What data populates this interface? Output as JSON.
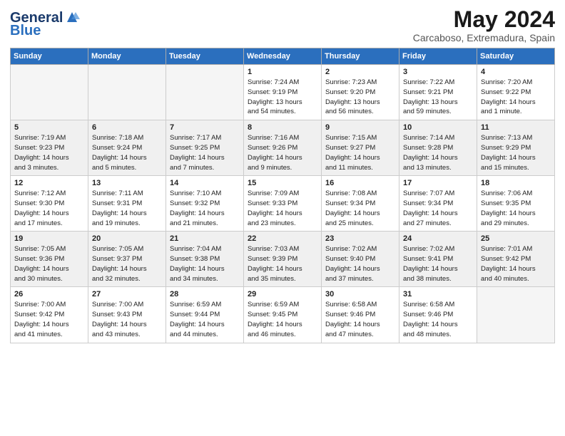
{
  "header": {
    "logo_line1": "General",
    "logo_line2": "Blue",
    "month": "May 2024",
    "location": "Carcaboso, Extremadura, Spain"
  },
  "days_of_week": [
    "Sunday",
    "Monday",
    "Tuesday",
    "Wednesday",
    "Thursday",
    "Friday",
    "Saturday"
  ],
  "weeks": [
    [
      {
        "day": "",
        "info": "",
        "empty": true
      },
      {
        "day": "",
        "info": "",
        "empty": true
      },
      {
        "day": "",
        "info": "",
        "empty": true
      },
      {
        "day": "1",
        "info": "Sunrise: 7:24 AM\nSunset: 9:19 PM\nDaylight: 13 hours\nand 54 minutes.",
        "empty": false
      },
      {
        "day": "2",
        "info": "Sunrise: 7:23 AM\nSunset: 9:20 PM\nDaylight: 13 hours\nand 56 minutes.",
        "empty": false
      },
      {
        "day": "3",
        "info": "Sunrise: 7:22 AM\nSunset: 9:21 PM\nDaylight: 13 hours\nand 59 minutes.",
        "empty": false
      },
      {
        "day": "4",
        "info": "Sunrise: 7:20 AM\nSunset: 9:22 PM\nDaylight: 14 hours\nand 1 minute.",
        "empty": false
      }
    ],
    [
      {
        "day": "5",
        "info": "Sunrise: 7:19 AM\nSunset: 9:23 PM\nDaylight: 14 hours\nand 3 minutes.",
        "empty": false
      },
      {
        "day": "6",
        "info": "Sunrise: 7:18 AM\nSunset: 9:24 PM\nDaylight: 14 hours\nand 5 minutes.",
        "empty": false
      },
      {
        "day": "7",
        "info": "Sunrise: 7:17 AM\nSunset: 9:25 PM\nDaylight: 14 hours\nand 7 minutes.",
        "empty": false
      },
      {
        "day": "8",
        "info": "Sunrise: 7:16 AM\nSunset: 9:26 PM\nDaylight: 14 hours\nand 9 minutes.",
        "empty": false
      },
      {
        "day": "9",
        "info": "Sunrise: 7:15 AM\nSunset: 9:27 PM\nDaylight: 14 hours\nand 11 minutes.",
        "empty": false
      },
      {
        "day": "10",
        "info": "Sunrise: 7:14 AM\nSunset: 9:28 PM\nDaylight: 14 hours\nand 13 minutes.",
        "empty": false
      },
      {
        "day": "11",
        "info": "Sunrise: 7:13 AM\nSunset: 9:29 PM\nDaylight: 14 hours\nand 15 minutes.",
        "empty": false
      }
    ],
    [
      {
        "day": "12",
        "info": "Sunrise: 7:12 AM\nSunset: 9:30 PM\nDaylight: 14 hours\nand 17 minutes.",
        "empty": false
      },
      {
        "day": "13",
        "info": "Sunrise: 7:11 AM\nSunset: 9:31 PM\nDaylight: 14 hours\nand 19 minutes.",
        "empty": false
      },
      {
        "day": "14",
        "info": "Sunrise: 7:10 AM\nSunset: 9:32 PM\nDaylight: 14 hours\nand 21 minutes.",
        "empty": false
      },
      {
        "day": "15",
        "info": "Sunrise: 7:09 AM\nSunset: 9:33 PM\nDaylight: 14 hours\nand 23 minutes.",
        "empty": false
      },
      {
        "day": "16",
        "info": "Sunrise: 7:08 AM\nSunset: 9:34 PM\nDaylight: 14 hours\nand 25 minutes.",
        "empty": false
      },
      {
        "day": "17",
        "info": "Sunrise: 7:07 AM\nSunset: 9:34 PM\nDaylight: 14 hours\nand 27 minutes.",
        "empty": false
      },
      {
        "day": "18",
        "info": "Sunrise: 7:06 AM\nSunset: 9:35 PM\nDaylight: 14 hours\nand 29 minutes.",
        "empty": false
      }
    ],
    [
      {
        "day": "19",
        "info": "Sunrise: 7:05 AM\nSunset: 9:36 PM\nDaylight: 14 hours\nand 30 minutes.",
        "empty": false
      },
      {
        "day": "20",
        "info": "Sunrise: 7:05 AM\nSunset: 9:37 PM\nDaylight: 14 hours\nand 32 minutes.",
        "empty": false
      },
      {
        "day": "21",
        "info": "Sunrise: 7:04 AM\nSunset: 9:38 PM\nDaylight: 14 hours\nand 34 minutes.",
        "empty": false
      },
      {
        "day": "22",
        "info": "Sunrise: 7:03 AM\nSunset: 9:39 PM\nDaylight: 14 hours\nand 35 minutes.",
        "empty": false
      },
      {
        "day": "23",
        "info": "Sunrise: 7:02 AM\nSunset: 9:40 PM\nDaylight: 14 hours\nand 37 minutes.",
        "empty": false
      },
      {
        "day": "24",
        "info": "Sunrise: 7:02 AM\nSunset: 9:41 PM\nDaylight: 14 hours\nand 38 minutes.",
        "empty": false
      },
      {
        "day": "25",
        "info": "Sunrise: 7:01 AM\nSunset: 9:42 PM\nDaylight: 14 hours\nand 40 minutes.",
        "empty": false
      }
    ],
    [
      {
        "day": "26",
        "info": "Sunrise: 7:00 AM\nSunset: 9:42 PM\nDaylight: 14 hours\nand 41 minutes.",
        "empty": false
      },
      {
        "day": "27",
        "info": "Sunrise: 7:00 AM\nSunset: 9:43 PM\nDaylight: 14 hours\nand 43 minutes.",
        "empty": false
      },
      {
        "day": "28",
        "info": "Sunrise: 6:59 AM\nSunset: 9:44 PM\nDaylight: 14 hours\nand 44 minutes.",
        "empty": false
      },
      {
        "day": "29",
        "info": "Sunrise: 6:59 AM\nSunset: 9:45 PM\nDaylight: 14 hours\nand 46 minutes.",
        "empty": false
      },
      {
        "day": "30",
        "info": "Sunrise: 6:58 AM\nSunset: 9:46 PM\nDaylight: 14 hours\nand 47 minutes.",
        "empty": false
      },
      {
        "day": "31",
        "info": "Sunrise: 6:58 AM\nSunset: 9:46 PM\nDaylight: 14 hours\nand 48 minutes.",
        "empty": false
      },
      {
        "day": "",
        "info": "",
        "empty": true
      }
    ]
  ]
}
